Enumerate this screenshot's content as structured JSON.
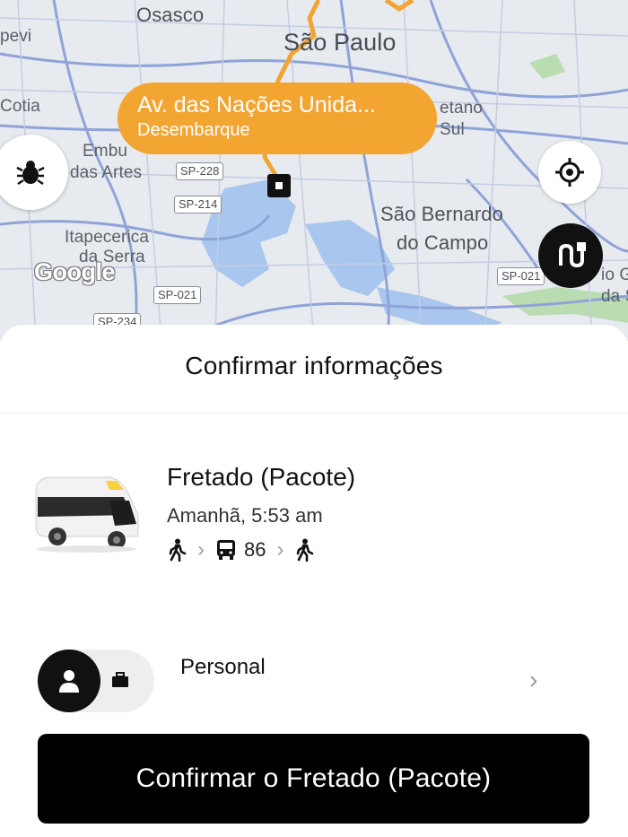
{
  "map": {
    "labels": {
      "osasco": "Osasco",
      "sao_paulo": "São Paulo",
      "pevi": "pevi",
      "cotia": "Cotia",
      "embu": "Embu\ndas Artes",
      "embu_l1": "Embu",
      "embu_l2": "das Artes",
      "itapecerica_l1": "Itapecerica",
      "itapecerica_l2": "da Serra",
      "caetano_l1": "etano",
      "caetano_l2": "Sul",
      "sao_bernardo_l1": "São Bernardo",
      "sao_bernardo_l2": "do Campo",
      "right_edge_l1": "io G",
      "right_edge_l2": "da S"
    },
    "shields": {
      "sp228": "SP-228",
      "sp214": "SP-214",
      "sp021": "SP-021",
      "sp234": "SP-234",
      "sp021_right": "SP-021"
    },
    "google": "Google",
    "callout": {
      "title": "Av. das Nações Unida...",
      "subtitle": "Desembarque"
    },
    "buttons": {
      "bug_icon": "bug-icon",
      "locate_icon": "locate-icon",
      "route_icon": "route-icon"
    },
    "colors": {
      "route": "#f3a532",
      "water": "#a8c6ee",
      "roads": "#8fa3d9",
      "park": "#b9ddb0"
    }
  },
  "sheet": {
    "title": "Confirmar informações",
    "ride": {
      "name": "Fretado (Pacote)",
      "time": "Amanhã, 5:53 am",
      "steps": [
        "walk-icon",
        "bus-icon",
        "walk-icon"
      ],
      "bus_number": "86"
    },
    "profile": {
      "label": "Personal",
      "icons": [
        "person-icon",
        "briefcase-icon"
      ]
    },
    "confirm_button": "Confirmar o Fretado (Pacote)"
  }
}
